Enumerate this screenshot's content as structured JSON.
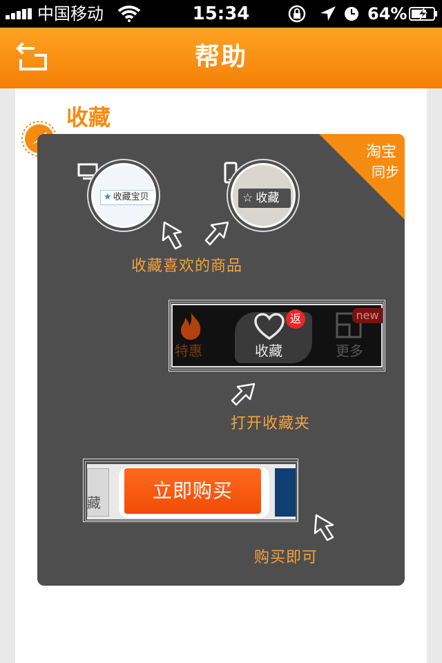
{
  "status_bar": {
    "carrier": "中国移动",
    "time": "15:34",
    "battery_percent": "64%"
  },
  "header": {
    "title": "帮助"
  },
  "section": {
    "title": "收藏",
    "corner_badge_line1": "淘宝",
    "corner_badge_line2": "同步",
    "step1": {
      "pc_chip_label": "收藏宝贝",
      "phone_chip_label": "收藏",
      "caption": "收藏喜欢的商品"
    },
    "step2": {
      "tabs": [
        "特惠",
        "收藏",
        "更多"
      ],
      "badge": "返",
      "new_tag": "new",
      "caption": "打开收藏夹"
    },
    "step3": {
      "left_text": "藏",
      "button_label": "立即购买",
      "caption": "购买即可"
    }
  },
  "colors": {
    "header_orange": "#f48009",
    "accent_orange": "#f68b12",
    "panel_gray": "#4e4e4e",
    "buy_button": "#f14c05"
  }
}
